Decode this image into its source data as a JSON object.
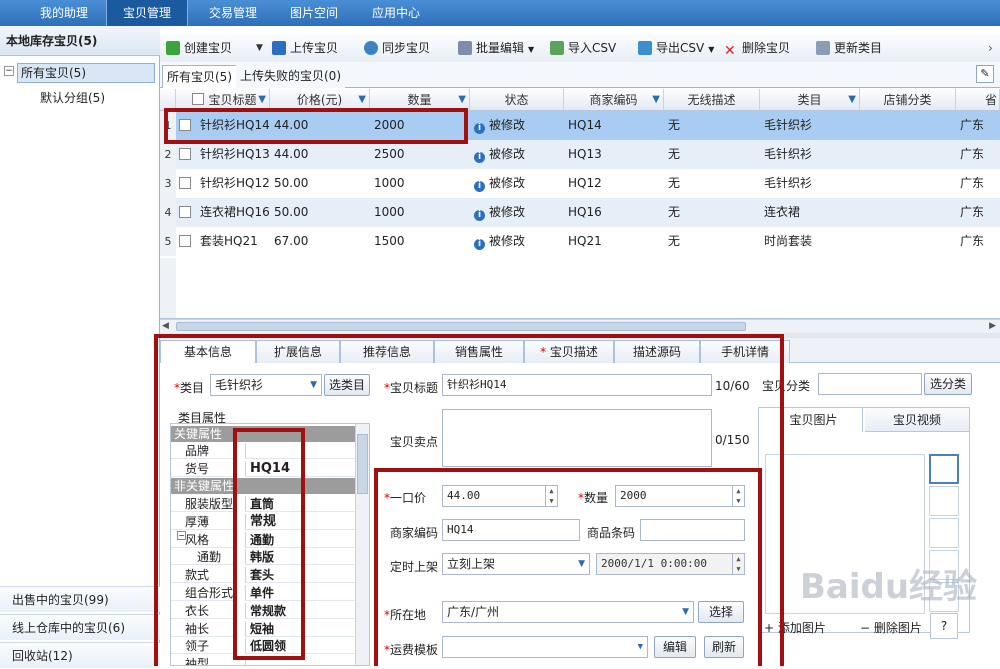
{
  "nav": {
    "tabs": [
      "我的助理",
      "宝贝管理",
      "交易管理",
      "图片空间",
      "应用中心"
    ]
  },
  "sidebar": {
    "header": "本地库存宝贝(5)",
    "tree": [
      {
        "label": "所有宝贝(5)"
      },
      {
        "label": "默认分组(5)"
      }
    ],
    "bottom": [
      "出售中的宝贝(99)",
      "线上仓库中的宝贝(6)",
      "回收站(12)"
    ]
  },
  "toolbar": {
    "items": [
      "创建宝贝",
      "上传宝贝",
      "同步宝贝",
      "批量编辑",
      "导入CSV",
      "导出CSV",
      "删除宝贝",
      "更新类目"
    ]
  },
  "list_tabs": [
    "所有宝贝(5)",
    "上传失败的宝贝(0)"
  ],
  "grid": {
    "columns": [
      "宝贝标题",
      "价格(元)",
      "数量",
      "状态",
      "商家编码",
      "无线描述",
      "类目",
      "店铺分类",
      "省"
    ],
    "rows": [
      {
        "n": "1",
        "title": "针织衫HQ14",
        "price": "44.00",
        "qty": "2000",
        "status": "被修改",
        "code": "HQ14",
        "wireless": "无",
        "cat": "毛针织衫",
        "prov": "广东"
      },
      {
        "n": "2",
        "title": "针织衫HQ13",
        "price": "44.00",
        "qty": "2500",
        "status": "被修改",
        "code": "HQ13",
        "wireless": "无",
        "cat": "毛针织衫",
        "prov": "广东"
      },
      {
        "n": "3",
        "title": "针织衫HQ12",
        "price": "50.00",
        "qty": "1000",
        "status": "被修改",
        "code": "HQ12",
        "wireless": "无",
        "cat": "毛针织衫",
        "prov": "广东"
      },
      {
        "n": "4",
        "title": "连衣裙HQ16",
        "price": "50.00",
        "qty": "1000",
        "status": "被修改",
        "code": "HQ16",
        "wireless": "无",
        "cat": "连衣裙",
        "prov": "广东"
      },
      {
        "n": "5",
        "title": "套装HQ21",
        "price": "67.00",
        "qty": "1500",
        "status": "被修改",
        "code": "HQ21",
        "wireless": "无",
        "cat": "时尚套装",
        "prov": "广东"
      }
    ]
  },
  "detail_tabs": [
    "基本信息",
    "扩展信息",
    "推荐信息",
    "销售属性",
    "宝贝描述",
    "描述源码",
    "手机详情"
  ],
  "form": {
    "category_label": "类目",
    "category_value": "毛针织衫",
    "category_btn": "选类目",
    "attr_title": "类目属性",
    "attr_key_section": "关键属性",
    "attr_nonkey_section": "非关键属性",
    "attrs_key": [
      {
        "k": "品牌",
        "v": ""
      },
      {
        "k": "货号",
        "v": "HQ14"
      }
    ],
    "attrs_nonkey": [
      {
        "k": "服装版型",
        "v": "直筒"
      },
      {
        "k": "厚薄",
        "v": "常规"
      },
      {
        "k": "风格",
        "v": "通勤"
      },
      {
        "k": "通勤",
        "v": "韩版"
      },
      {
        "k": "款式",
        "v": "套头"
      },
      {
        "k": "组合形式",
        "v": "单件"
      },
      {
        "k": "衣长",
        "v": "常规款"
      },
      {
        "k": "袖长",
        "v": "短袖"
      },
      {
        "k": "领子",
        "v": "低圆领"
      },
      {
        "k": "袖型",
        "v": ""
      }
    ],
    "title_label": "宝贝标题",
    "title_value": "针织衫HQ14",
    "title_count": "10/60",
    "selling_label": "宝贝卖点",
    "selling_count": "0/150",
    "price_label": "一口价",
    "price_value": "44.00",
    "qty_label": "数量",
    "qty_value": "2000",
    "code_label": "商家编码",
    "code_value": "HQ14",
    "barcode_label": "商品条码",
    "timing_label": "定时上架",
    "timing_value": "立刻上架",
    "timing_date": "2000/1/1 0:00:00",
    "location_label": "所在地",
    "location_value": "广东/广州",
    "location_btn": "选择",
    "freight_label": "运费模板",
    "edit_btn": "编辑",
    "refresh_btn": "刷新",
    "shopcat_label": "宝贝分类",
    "shopcat_btn": "选分类",
    "media_tabs": [
      "宝贝图片",
      "宝贝视频"
    ],
    "add_img": "添加图片",
    "del_img": "删除图片",
    "help": "?"
  },
  "watermark": "Baidu经验"
}
